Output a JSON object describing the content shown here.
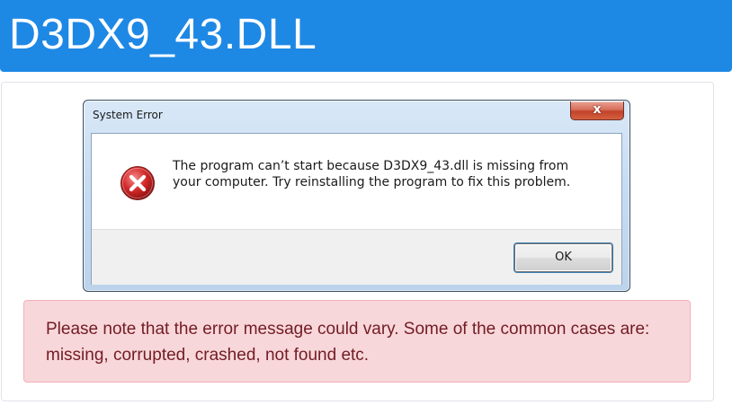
{
  "header": {
    "title": "D3DX9_43.DLL"
  },
  "dialog": {
    "title": "System Error",
    "close_label": "x",
    "message": "The program can’t start because D3DX9_43.dll is missing from your computer. Try reinstalling the program to fix this problem.",
    "ok_label": "OK",
    "icon": "error-icon"
  },
  "alert": {
    "text": "Please note that the error message could vary. Some of the common cases are: missing, corrupted, crashed, not found etc."
  },
  "colors": {
    "header_bg": "#1e88e5",
    "alert_bg": "#f8d7da",
    "alert_text": "#721c24",
    "error_icon": "#d42a2a"
  }
}
